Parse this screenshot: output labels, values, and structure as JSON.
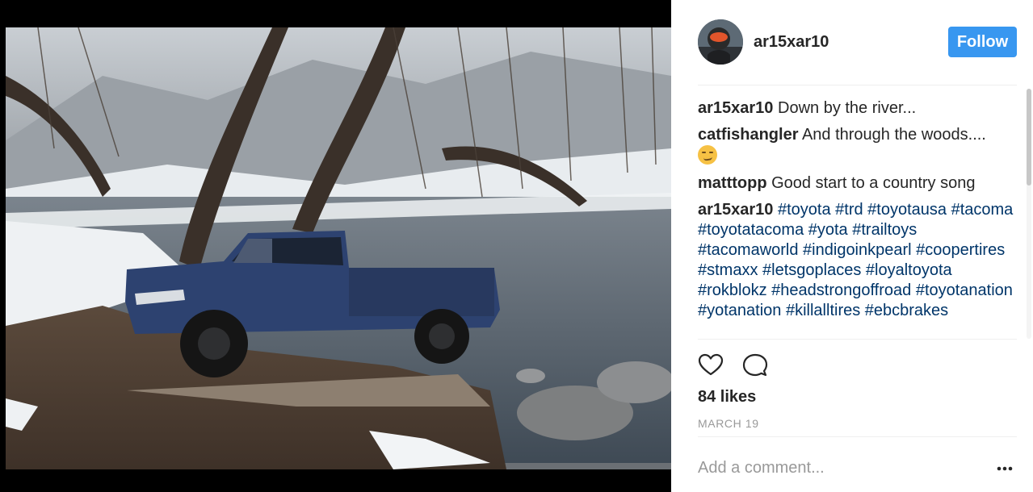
{
  "post": {
    "username": "ar15xar10",
    "follow_label": "Follow"
  },
  "comments": [
    {
      "author": "ar15xar10",
      "text": "Down by the river..."
    },
    {
      "author": "catfishangler",
      "text": "And through the woods....",
      "emoji": "smirking-face"
    },
    {
      "author": "matttopp",
      "text": "Good start to a country song"
    },
    {
      "author": "ar15xar10",
      "tags": "#toyota #trd #toyotausa #tacoma #toyotatacoma #yota #trailtoys #tacomaworld #indigoinkpearl #coopertires #stmaxx #letsgoplaces #loyaltoyota #rokblokz #headstrongoffroad #toyotanation #yotanation #killalltires #ebcbrakes"
    }
  ],
  "likes": "84 likes",
  "date": "MARCH 19",
  "add_comment_placeholder": "Add a comment...",
  "colors": {
    "follow_button": "#3897f0",
    "hashtag": "#003569",
    "secondary_text": "#999999"
  },
  "icons": [
    "heart-icon",
    "comment-icon",
    "more-options-icon"
  ]
}
